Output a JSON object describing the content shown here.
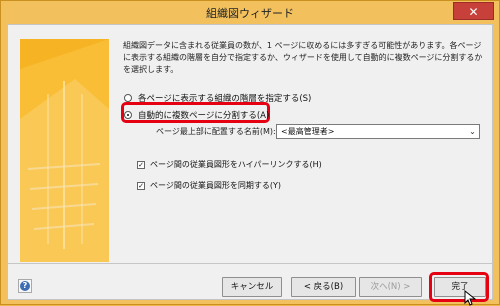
{
  "window": {
    "title": "組織図ウィザード",
    "close_label": "✕"
  },
  "content": {
    "intro": "組織図データに含まれる従業員の数が、1 ページに収めるには多すぎる可能性があります。各ページに表示する組織の階層を自分で指定するか、ウィザードを使用して自動的に複数ページに分割するかを選択します。",
    "radio_specify": "各ページに表示する組織の階層を指定する(S)",
    "radio_auto": "自動的に複数ページに分割する(A)",
    "placement_label": "ページ最上部に配置する名前(M):",
    "placement_value": "<最高管理者>",
    "check_hyperlink": "ページ間の従業員図形をハイパーリンクする(H)",
    "check_sync": "ページ間の従業員図形を同期する(Y)",
    "check_mark": "✓"
  },
  "buttons": {
    "help": "?",
    "cancel": "キャンセル",
    "back": "< 戻る(B)",
    "next": "次へ(N) >",
    "finish": "完了"
  },
  "colors": {
    "highlight": "#e50012",
    "accent": "#f6b323"
  }
}
